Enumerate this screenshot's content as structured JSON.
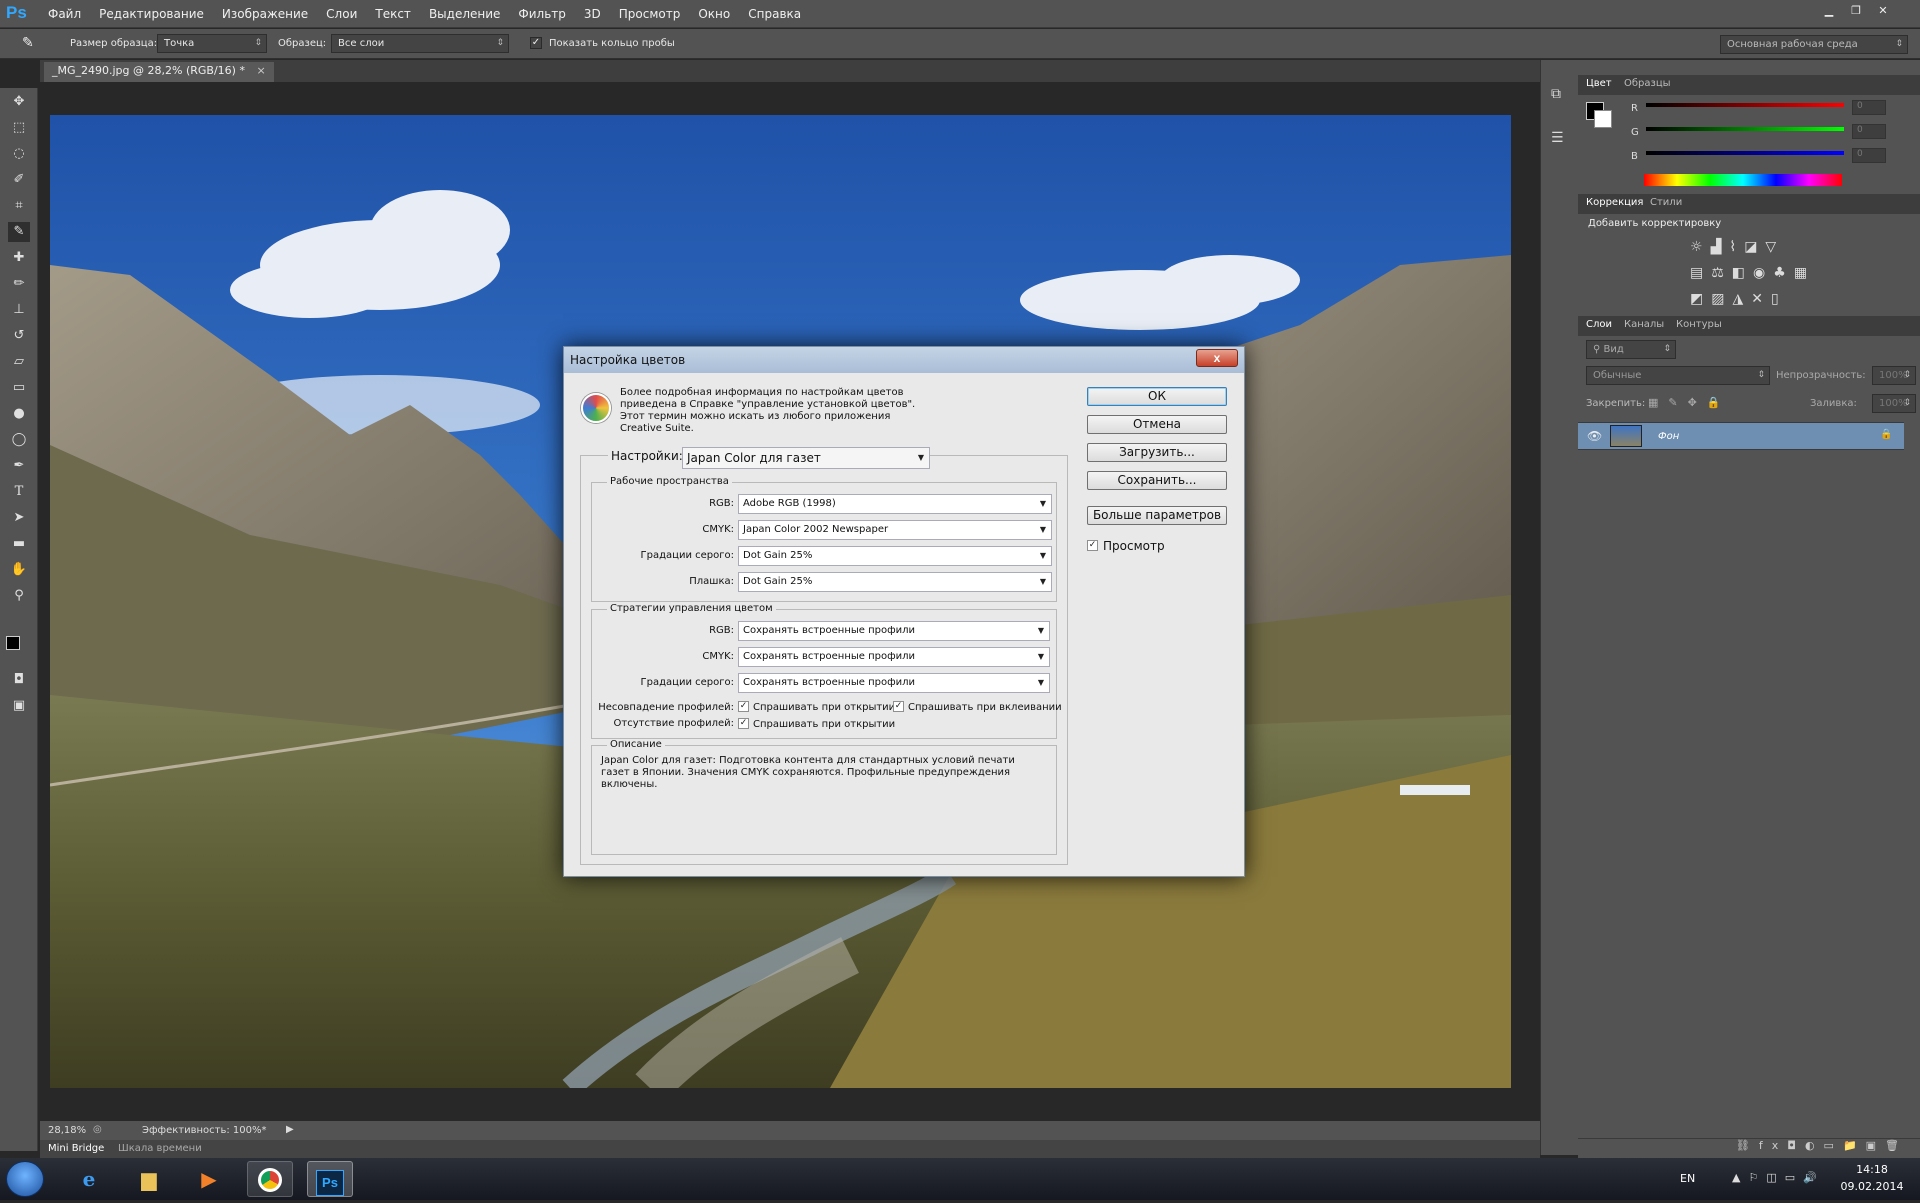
{
  "menubar": {
    "logo": "Ps",
    "items": [
      "Файл",
      "Редактирование",
      "Изображение",
      "Слои",
      "Текст",
      "Выделение",
      "Фильтр",
      "3D",
      "Просмотр",
      "Окно",
      "Справка"
    ]
  },
  "options": {
    "sample_size_label": "Размер образца:",
    "sample_size_value": "Точка",
    "sample_label": "Образец:",
    "sample_value": "Все слои",
    "show_ring_label": "Показать кольцо пробы",
    "workspace": "Основная рабочая среда"
  },
  "document": {
    "tab_title": "_MG_2490.jpg @ 28,2% (RGB/16) *",
    "zoom": "28,18%",
    "efficiency": "Эффективность: 100%*"
  },
  "bottom_tabs": [
    "Mini Bridge",
    "Шкала времени"
  ],
  "color_panel": {
    "tabs": [
      "Цвет",
      "Образцы"
    ],
    "channels": [
      {
        "name": "R",
        "value": "0"
      },
      {
        "name": "G",
        "value": "0"
      },
      {
        "name": "B",
        "value": "0"
      }
    ]
  },
  "adjustments_panel": {
    "tabs": [
      "Коррекция",
      "Стили"
    ],
    "heading": "Добавить корректировку"
  },
  "layers_panel": {
    "tabs": [
      "Слои",
      "Каналы",
      "Контуры"
    ],
    "filter": "Вид",
    "blend_mode": "Обычные",
    "opacity_label": "Непрозрачность:",
    "opacity_value": "100%",
    "lock_label": "Закрепить:",
    "fill_label": "Заливка:",
    "fill_value": "100%",
    "layer_name": "Фон"
  },
  "dialog": {
    "title": "Настройка цветов",
    "close": "x",
    "info": "Более подробная информация по настройкам цветов приведена в Справке \"управление установкой цветов\". Этот термин можно искать из любого приложения Creative Suite.",
    "settings_label": "Настройки:",
    "settings_value": "Japan Color для газет",
    "buttons": {
      "ok": "ОК",
      "cancel": "Отмена",
      "load": "Загрузить...",
      "save": "Сохранить...",
      "more": "Больше параметров"
    },
    "preview_label": "Просмотр",
    "working_spaces": {
      "title": "Рабочие пространства",
      "rows": [
        {
          "label": "RGB:",
          "value": "Adobe RGB (1998)"
        },
        {
          "label": "CMYK:",
          "value": "Japan Color 2002 Newspaper"
        },
        {
          "label": "Градации серого:",
          "value": "Dot Gain 25%"
        },
        {
          "label": "Плашка:",
          "value": "Dot Gain 25%"
        }
      ]
    },
    "policies": {
      "title": "Стратегии управления цветом",
      "rows": [
        {
          "label": "RGB:",
          "value": "Сохранять встроенные профили"
        },
        {
          "label": "CMYK:",
          "value": "Сохранять встроенные профили"
        },
        {
          "label": "Градации серого:",
          "value": "Сохранять встроенные профили"
        }
      ],
      "mismatch_label": "Несовпадение профилей:",
      "ask_open": "Спрашивать при открытии",
      "ask_paste": "Спрашивать при вклеивании",
      "missing_label": "Отсутствие профилей:",
      "ask_open2": "Спрашивать при открытии"
    },
    "description": {
      "title": "Описание",
      "text": "Japan Color для газет:  Подготовка контента для стандартных условий печати газет в Японии. Значения CMYK сохраняются. Профильные предупреждения включены."
    }
  },
  "taskbar": {
    "lang": "EN",
    "time": "14:18",
    "date": "09.02.2014"
  }
}
